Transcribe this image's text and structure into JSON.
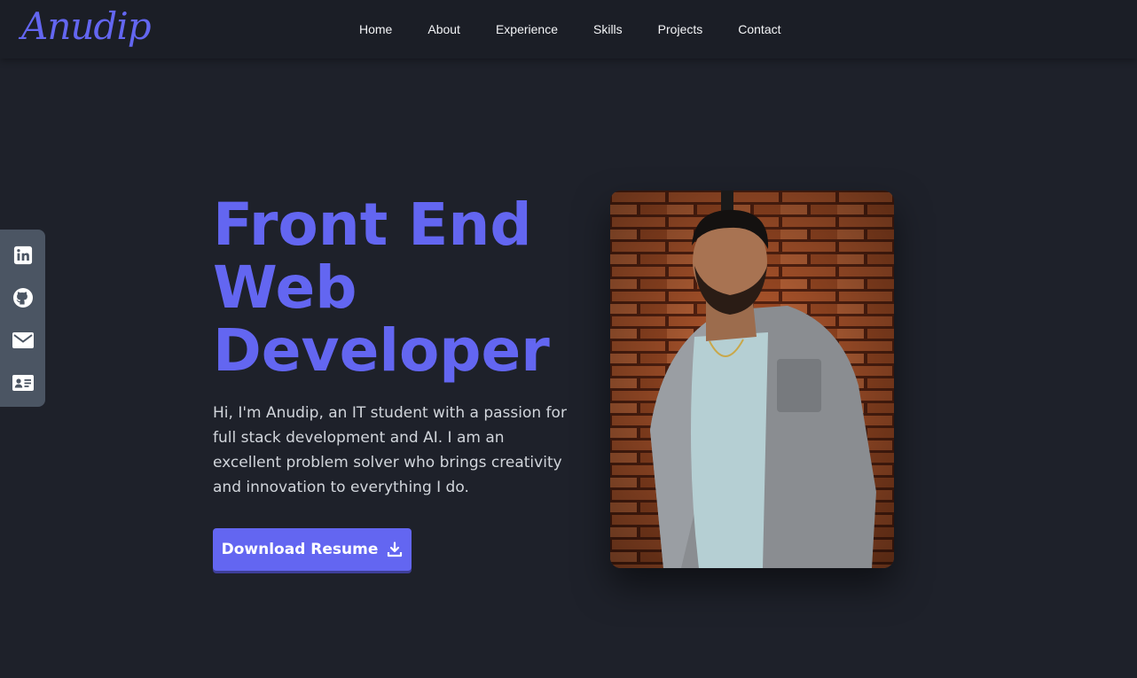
{
  "brand": {
    "logo_text": "Anudip",
    "accent_color": "#6366f1"
  },
  "nav": {
    "items": [
      {
        "label": "Home"
      },
      {
        "label": "About"
      },
      {
        "label": "Experience"
      },
      {
        "label": "Skills"
      },
      {
        "label": "Projects"
      },
      {
        "label": "Contact"
      }
    ]
  },
  "social": {
    "icons": [
      "linkedin-icon",
      "github-icon",
      "email-icon",
      "contact-card-icon"
    ]
  },
  "hero": {
    "title_lines": [
      "Front End",
      "Web",
      "Developer"
    ],
    "description": "Hi, I'm Anudip, an IT student with a passion for full stack development and AI. I am an excellent problem solver who brings creativity and innovation to everything I do.",
    "button_label": "Download Resume",
    "button_icon": "download-icon"
  },
  "colors": {
    "background": "#1e212a",
    "navbar": "#1b1e26",
    "social_bar": "#4b5563",
    "text": "#d1d5db"
  }
}
